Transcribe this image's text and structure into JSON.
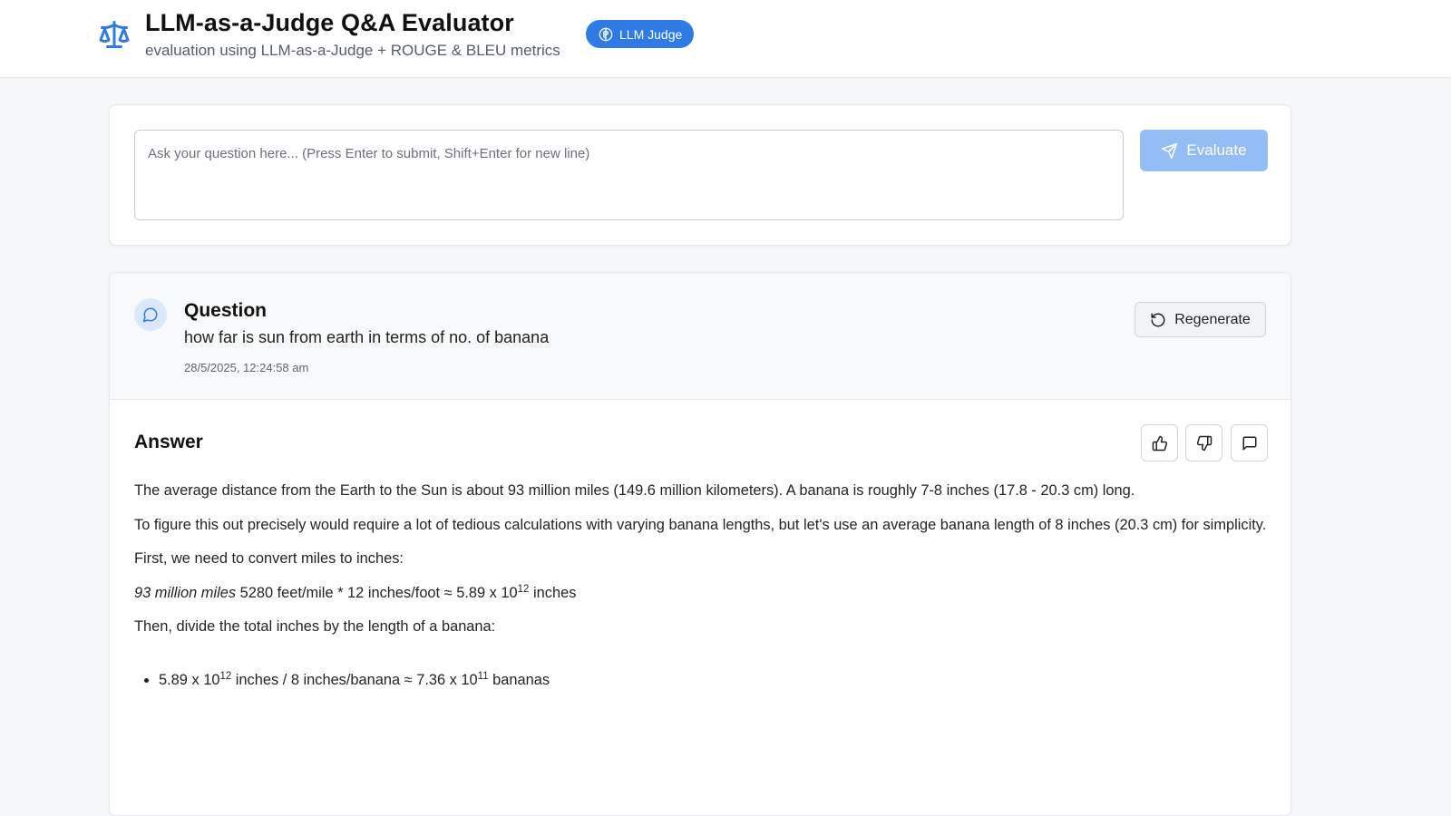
{
  "header": {
    "title": "LLM-as-a-Judge Q&A Evaluator",
    "subtitle": "evaluation using LLM-as-a-Judge + ROUGE & BLEU metrics",
    "badge_label": "LLM Judge",
    "logo_icon": "scale-icon",
    "badge_icon": "brain-icon"
  },
  "input": {
    "placeholder": "Ask your question here... (Press Enter to submit, Shift+Enter for new line)",
    "value": "",
    "evaluate_label": "Evaluate",
    "evaluate_icon": "send-icon"
  },
  "result": {
    "question_label": "Question",
    "question_text": "how far is sun from earth in terms of no. of banana",
    "timestamp": "28/5/2025, 12:24:58 am",
    "regenerate_label": "Regenerate",
    "answer_label": "Answer",
    "answer": {
      "p1": "The average distance from the Earth to the Sun is about 93 million miles (149.6 million kilometers). A banana is roughly 7-8 inches (17.8 - 20.3 cm) long.",
      "p2": "To figure this out precisely would require a lot of tedious calculations with varying banana lengths, but let's use an average banana length of 8 inches (20.3 cm) for simplicity.",
      "p3": "First, we need to convert miles to inches:",
      "calc_italic": "93 million miles",
      "calc_part1": " 5280 feet/mile * 12 inches/foot ≈ 5.89 x 10",
      "calc_exp": "12",
      "calc_part2": " inches",
      "p5": "Then, divide the total inches by the length of a banana:",
      "bullet_part1": "5.89 x 10",
      "bullet_exp1": "12",
      "bullet_part2": " inches / 8 inches/banana ≈ 7.36 x 10",
      "bullet_exp2": "11",
      "bullet_part3": " bananas"
    }
  },
  "colors": {
    "accent": "#2f7be6",
    "accent_disabled": "#93bdf5",
    "background": "#f6f7f9"
  }
}
